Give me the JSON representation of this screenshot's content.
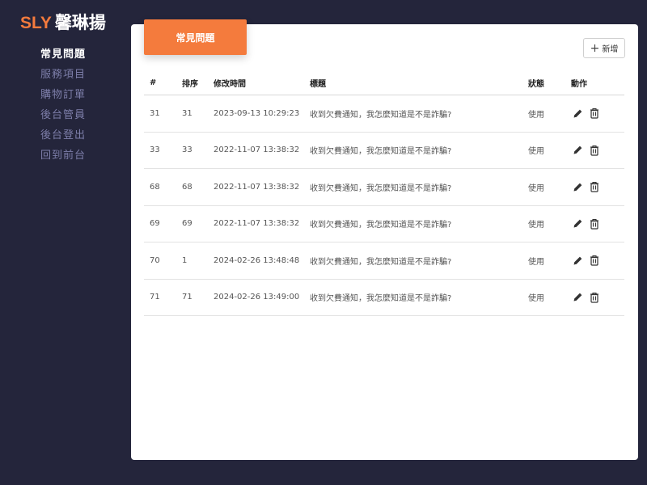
{
  "brand": {
    "en": "SLY",
    "zh": "馨琳揚"
  },
  "sidebar": {
    "items": [
      {
        "label": "常見問題",
        "active": true
      },
      {
        "label": "服務項目",
        "active": false
      },
      {
        "label": "購物訂單",
        "active": false
      },
      {
        "label": "後台管員",
        "active": false
      },
      {
        "label": "後台登出",
        "active": false
      },
      {
        "label": "回到前台",
        "active": false
      }
    ]
  },
  "main": {
    "tab_title": "常見問題",
    "add_button": {
      "icon": "plus-icon",
      "label": "新增"
    },
    "table": {
      "headers": {
        "id": "#",
        "sort": "排序",
        "modified": "修改時間",
        "title": "標題",
        "status": "狀態",
        "action": "動作"
      },
      "rows": [
        {
          "id": "31",
          "sort": "31",
          "modified": "2023-09-13 10:29:23",
          "title": "收到欠費通知，我怎麼知道是不是詐騙?",
          "status": "使用"
        },
        {
          "id": "33",
          "sort": "33",
          "modified": "2022-11-07 13:38:32",
          "title": "收到欠費通知，我怎麼知道是不是詐騙?",
          "status": "使用"
        },
        {
          "id": "68",
          "sort": "68",
          "modified": "2022-11-07 13:38:32",
          "title": "收到欠費通知，我怎麼知道是不是詐騙?",
          "status": "使用"
        },
        {
          "id": "69",
          "sort": "69",
          "modified": "2022-11-07 13:38:32",
          "title": "收到欠費通知，我怎麼知道是不是詐騙?",
          "status": "使用"
        },
        {
          "id": "70",
          "sort": "1",
          "modified": "2024-02-26 13:48:48",
          "title": "收到欠費通知，我怎麼知道是不是詐騙?",
          "status": "使用"
        },
        {
          "id": "71",
          "sort": "71",
          "modified": "2024-02-26 13:49:00",
          "title": "收到欠費通知，我怎麼知道是不是詐騙?",
          "status": "使用"
        }
      ],
      "row_actions": [
        {
          "icon": "pencil-icon",
          "name": "edit"
        },
        {
          "icon": "trash-icon",
          "name": "delete"
        }
      ]
    }
  },
  "colors": {
    "background": "#24253b",
    "accent": "#f47b3d",
    "nav_inactive": "#7d7ea9",
    "card": "#ffffff"
  }
}
